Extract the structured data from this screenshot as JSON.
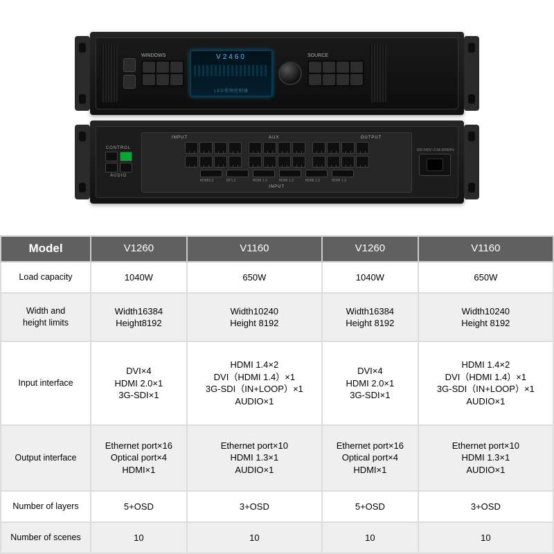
{
  "photo": {
    "model_label": "V2460",
    "screen_sub": "LED视频控制器",
    "windows_label": "WINDOWS",
    "source_label": "SOURCE",
    "back": {
      "control": "CONTROL",
      "input": "INPUT",
      "output": "OUTPUT",
      "aux": "AUX",
      "audio": "AUDIO",
      "psu": "100-240V~2.5A 50/60Hz",
      "hdmi_labels": [
        "HDMI2.0",
        "DP1.2",
        "HDMI 1.3",
        "HDMI 1.3",
        "HDMI 1.3",
        "HDMI 1.3"
      ]
    }
  },
  "table": {
    "corner": "Model",
    "cols": [
      "V1260",
      "V1160",
      "V1260",
      "V1160"
    ],
    "rows": [
      {
        "head": "Load capacity",
        "cells": [
          "1040W",
          "650W",
          "1040W",
          "650W"
        ]
      },
      {
        "head": "Width and\nheight limits",
        "cells": [
          "Width16384\nHeight8192",
          "Width10240\nHeight 8192",
          "Width16384\nHeight 8192",
          "Width10240\nHeight 8192"
        ]
      },
      {
        "head": "Input interface",
        "cells": [
          "DVI×4\nHDMI 2.0×1\n3G-SDI×1",
          "HDMI 1.4×2\nDVI（HDMI 1.4）×1\n3G-SDI（IN+LOOP）×1\nAUDIO×1",
          "DVI×4\nHDMI 2.0×1\n3G-SDI×1",
          "HDMI 1.4×2\nDVI（HDMI 1.4）×1\n3G-SDI（IN+LOOP）×1\nAUDIO×1"
        ]
      },
      {
        "head": "Output interface",
        "cells": [
          "Ethernet port×16\nOptical port×4\nHDMI×1",
          "Ethernet port×10\nHDMI 1.3×1\nAUDIO×1",
          "Ethernet port×16\nOptical port×4\nHDMI×1",
          "Ethernet port×10\nHDMI 1.3×1\nAUDIO×1"
        ]
      },
      {
        "head": "Number of layers",
        "cells": [
          "5+OSD",
          "3+OSD",
          "5+OSD",
          "3+OSD"
        ]
      },
      {
        "head": "Number of scenes",
        "cells": [
          "10",
          "10",
          "10",
          "10"
        ]
      }
    ]
  }
}
